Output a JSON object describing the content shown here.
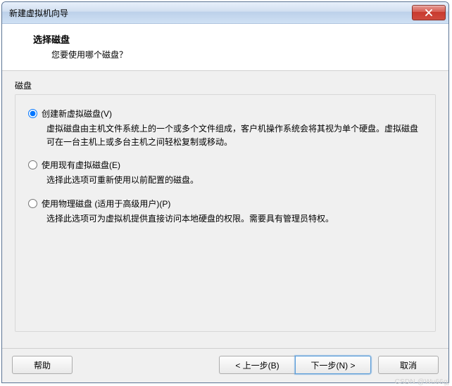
{
  "window": {
    "title": "新建虚拟机向导"
  },
  "header": {
    "title": "选择磁盘",
    "subtitle": "您要使用哪个磁盘？"
  },
  "group": {
    "label": "磁盘"
  },
  "options": {
    "create": {
      "label": "创建新虚拟磁盘(V)",
      "desc": "虚拟磁盘由主机文件系统上的一个或多个文件组成，客户机操作系统会将其视为单个硬盘。虚拟磁盘可在一台主机上或多台主机之间轻松复制或移动。",
      "selected": true
    },
    "existing": {
      "label": "使用现有虚拟磁盘(E)",
      "desc": "选择此选项可重新使用以前配置的磁盘。",
      "selected": false
    },
    "physical": {
      "label": "使用物理磁盘 (适用于高级用户)(P)",
      "desc": "选择此选项可为虚拟机提供直接访问本地硬盘的权限。需要具有管理员特权。",
      "selected": false
    }
  },
  "footer": {
    "help": "帮助",
    "back": "< 上一步(B)",
    "next": "下一步(N) >",
    "cancel": "取消"
  },
  "watermark": "CSDN @Wu66gj"
}
